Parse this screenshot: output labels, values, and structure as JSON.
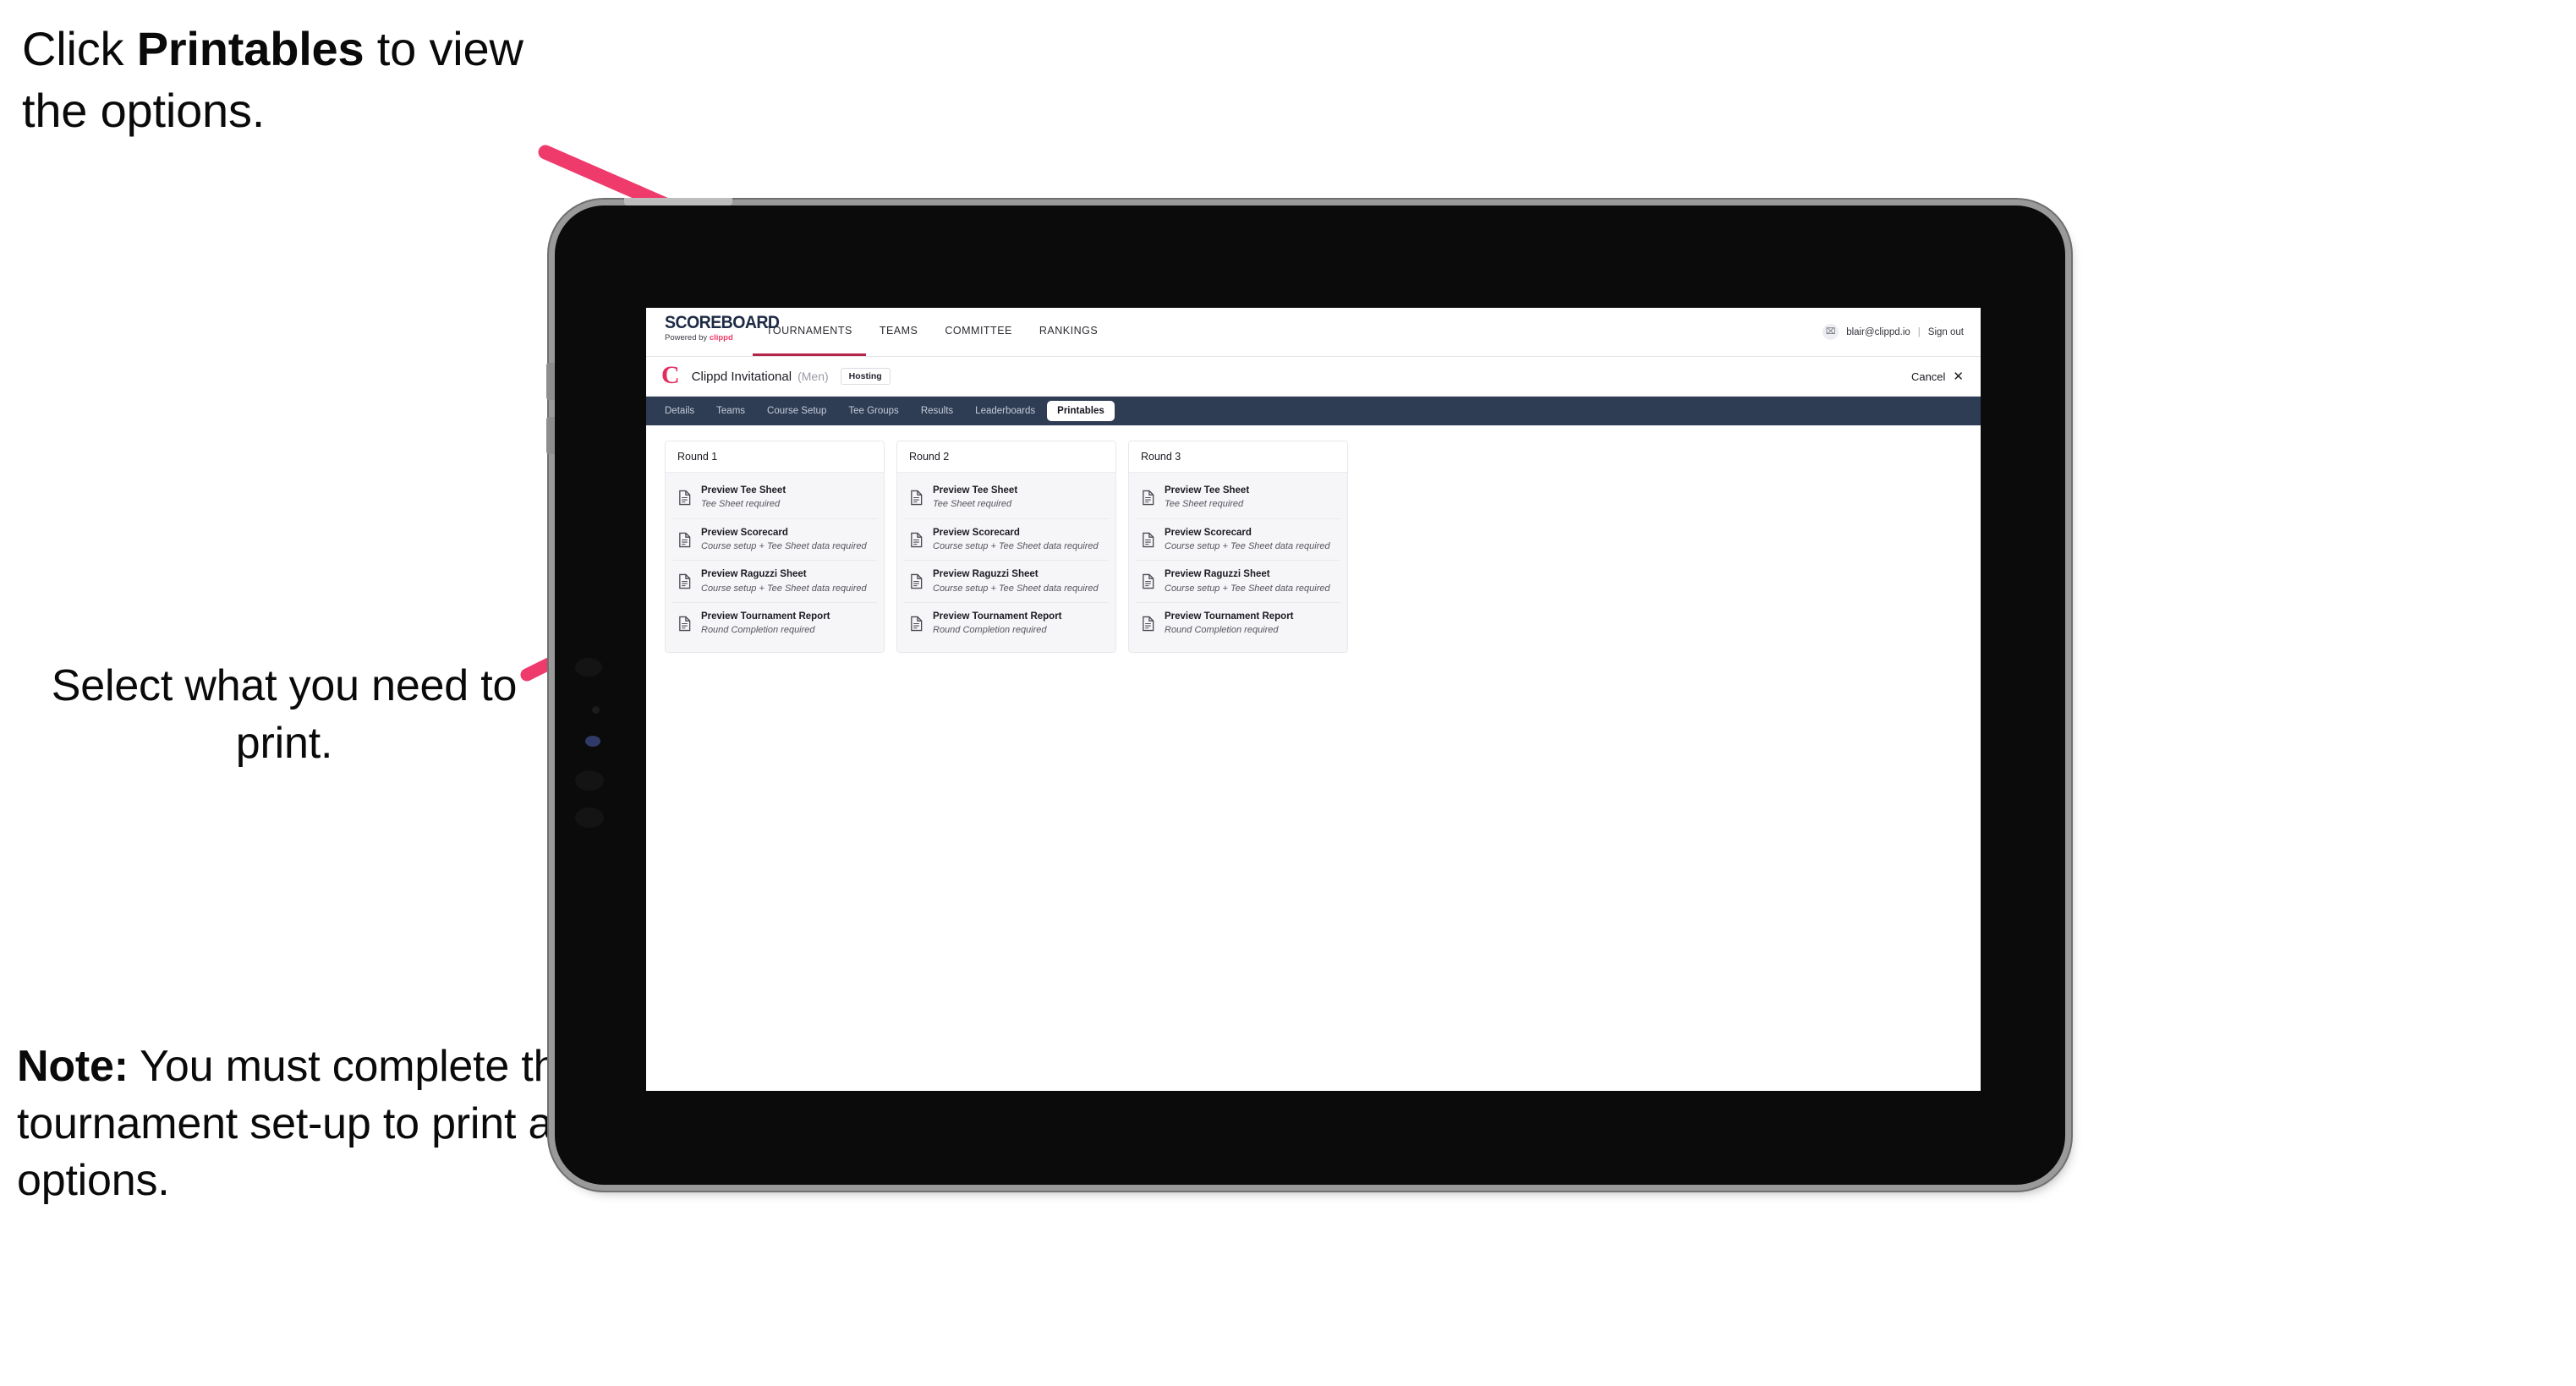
{
  "annotations": {
    "click_prefix": "Click ",
    "click_bold": "Printables",
    "click_suffix": " to view the options.",
    "select": "Select what you need to print.",
    "note_bold": "Note:",
    "note_rest": " You must complete the tournament set-up to print all the options."
  },
  "colors": {
    "arrow_pink": "#ef3a6c",
    "tab_bar_navy": "#2e3c54",
    "brand_pink": "#e32d5e",
    "nav_active_underline": "#b4244b"
  },
  "app": {
    "logo": {
      "wordmark": "SCOREBOARD",
      "powered_by": "Powered by ",
      "brand": "clippd"
    },
    "top_nav": [
      {
        "label": "TOURNAMENTS",
        "active": true
      },
      {
        "label": "TEAMS",
        "active": false
      },
      {
        "label": "COMMITTEE",
        "active": false
      },
      {
        "label": "RANKINGS",
        "active": false
      }
    ],
    "account": {
      "avatar_glyph": "⌧",
      "email": "blair@clippd.io",
      "separator": "|",
      "sign_out": "Sign out"
    },
    "tournament_bar": {
      "mark": "C",
      "title": "Clippd Invitational",
      "gender": "(Men)",
      "status_badge": "Hosting",
      "cancel_label": "Cancel",
      "cancel_glyph": "✕"
    },
    "tabs": [
      {
        "label": "Details",
        "active": false
      },
      {
        "label": "Teams",
        "active": false
      },
      {
        "label": "Course Setup",
        "active": false
      },
      {
        "label": "Tee Groups",
        "active": false
      },
      {
        "label": "Results",
        "active": false
      },
      {
        "label": "Leaderboards",
        "active": false
      },
      {
        "label": "Printables",
        "active": true
      }
    ],
    "rounds": [
      {
        "heading": "Round 1",
        "items": [
          {
            "title": "Preview Tee Sheet",
            "requirement": "Tee Sheet required"
          },
          {
            "title": "Preview Scorecard",
            "requirement": "Course setup + Tee Sheet data required"
          },
          {
            "title": "Preview Raguzzi Sheet",
            "requirement": "Course setup + Tee Sheet data required"
          },
          {
            "title": "Preview Tournament Report",
            "requirement": "Round Completion required"
          }
        ]
      },
      {
        "heading": "Round 2",
        "items": [
          {
            "title": "Preview Tee Sheet",
            "requirement": "Tee Sheet required"
          },
          {
            "title": "Preview Scorecard",
            "requirement": "Course setup + Tee Sheet data required"
          },
          {
            "title": "Preview Raguzzi Sheet",
            "requirement": "Course setup + Tee Sheet data required"
          },
          {
            "title": "Preview Tournament Report",
            "requirement": "Round Completion required"
          }
        ]
      },
      {
        "heading": "Round 3",
        "items": [
          {
            "title": "Preview Tee Sheet",
            "requirement": "Tee Sheet required"
          },
          {
            "title": "Preview Scorecard",
            "requirement": "Course setup + Tee Sheet data required"
          },
          {
            "title": "Preview Raguzzi Sheet",
            "requirement": "Course setup + Tee Sheet data required"
          },
          {
            "title": "Preview Tournament Report",
            "requirement": "Round Completion required"
          }
        ]
      }
    ]
  }
}
